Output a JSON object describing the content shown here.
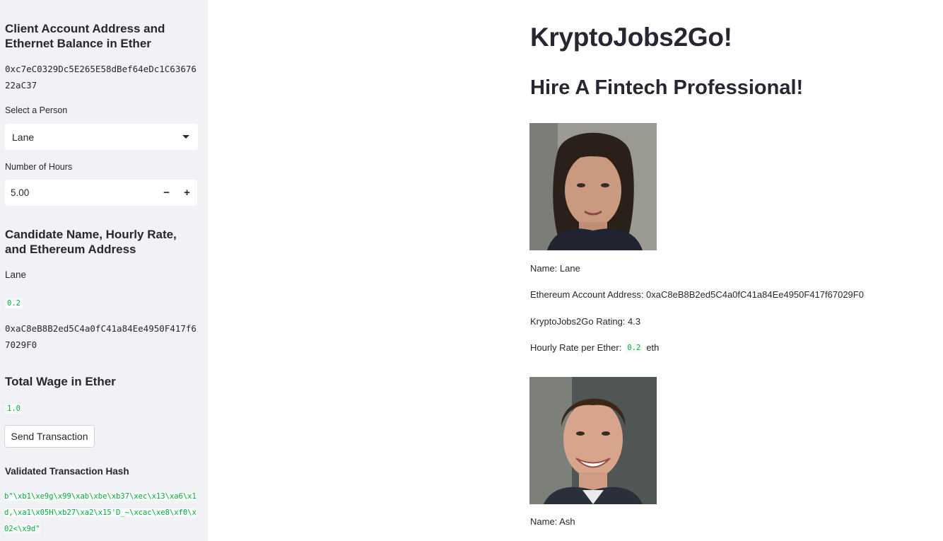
{
  "sidebar": {
    "client_heading": "Client Account Address and Ethernet Balance in Ether",
    "client_address": "0xc7eC0329Dc5E265E58dBef64eDc1C6367622aC37",
    "select_label": "Select a Person",
    "select_value": "Lane",
    "hours_label": "Number of Hours",
    "hours_value": "5.00",
    "minus_symbol": "−",
    "plus_symbol": "+",
    "candidate_heading": "Candidate Name, Hourly Rate, and Ethereum Address",
    "candidate_name": "Lane",
    "candidate_rate": "0.2",
    "candidate_address": "0xaC8eB8B2ed5C4a0fC41a84Ee4950F417f67029F0",
    "wage_heading": "Total Wage in Ether",
    "wage_value": "1.0",
    "send_button": "Send Transaction",
    "hash_heading": "Validated Transaction Hash",
    "hash_value": "b\"\\xb1\\xe9g\\x99\\xab\\xbe\\xb37\\xec\\x13\\xa6\\x1d,\\xa1\\x05H\\xb27\\xa2\\x15'D_~\\xcac\\xe8\\xf0\\x02<\\x9d\""
  },
  "main": {
    "title": "KryptoJobs2Go!",
    "subtitle": "Hire A Fintech Professional!",
    "candidates": [
      {
        "name_line": "Name: Lane",
        "address_line": "Ethereum Account Address: 0xaC8eB8B2ed5C4a0fC41a84Ee4950F417f67029F0",
        "rating_line": "KryptoJobs2Go Rating: 4.3",
        "rate_prefix": "Hourly Rate per Ether:",
        "rate_value": "0.2",
        "rate_suffix": "eth"
      },
      {
        "name_line": "Name: Ash"
      }
    ]
  },
  "colors": {
    "sidebar_bg": "#f0f2f6",
    "code_green": "#09ab3b",
    "text": "#262730"
  }
}
